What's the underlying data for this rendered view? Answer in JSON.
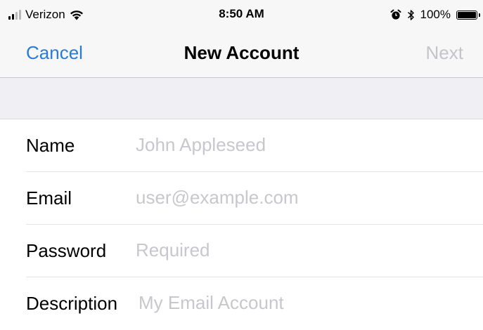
{
  "status_bar": {
    "carrier": "Verizon",
    "time": "8:50 AM",
    "battery_percent": "100%",
    "signal_bars_filled": 2,
    "signal_bars_total": 4,
    "icons": [
      "cellular-signal-icon",
      "wifi-icon",
      "alarm-icon",
      "bluetooth-icon",
      "battery-icon"
    ]
  },
  "nav": {
    "cancel_label": "Cancel",
    "title": "New Account",
    "next_label": "Next",
    "next_enabled": false
  },
  "form": {
    "fields": [
      {
        "label": "Name",
        "value": "",
        "placeholder": "John Appleseed"
      },
      {
        "label": "Email",
        "value": "",
        "placeholder": "user@example.com"
      },
      {
        "label": "Password",
        "value": "",
        "placeholder": "Required"
      },
      {
        "label": "Description",
        "value": "",
        "placeholder": "My Email Account"
      }
    ]
  },
  "colors": {
    "accent": "#2b7bd6",
    "disabled": "#c4c4c9",
    "placeholder": "#c7c7cd",
    "bar_background": "#f7f7f7",
    "grouped_background": "#efeff4"
  }
}
